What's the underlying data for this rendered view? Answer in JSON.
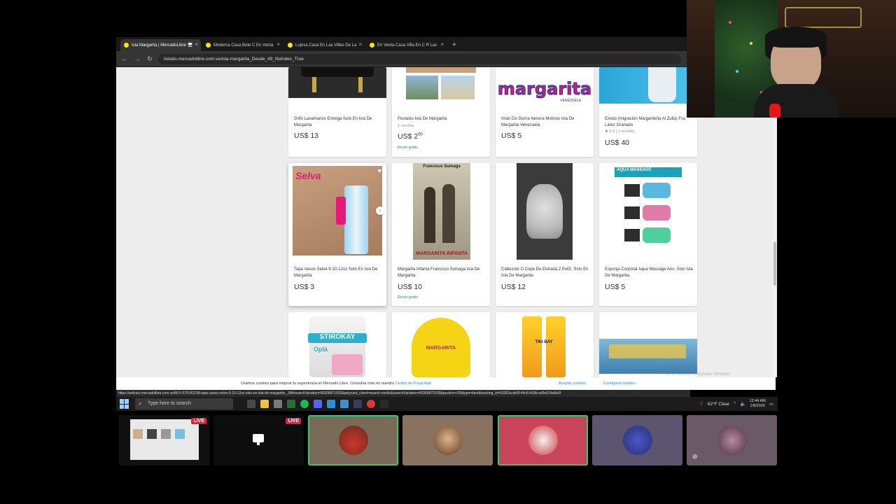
{
  "browser": {
    "tabs": [
      {
        "label": "Isla Margarita | MercadoLibre 🖥",
        "active": true
      },
      {
        "label": "Moderna Casa Bote C En Venta",
        "active": false
      },
      {
        "label": "Lujosa Casa En Las Villas De La",
        "active": false
      },
      {
        "label": "En Venta Casa Villa En C R Las",
        "active": false
      }
    ],
    "new_tab": "+",
    "url": "listado.mercadolibre.com.ve/isla-margarita_Desde_49_NoIndex_True",
    "nav": {
      "back": "←",
      "forward": "→",
      "reload": "↻"
    }
  },
  "products_row1": [
    {
      "title": "Grifo Lavamanos Entrega Solo En Isla De Margarita",
      "meta": "",
      "price": "US$ 13",
      "ship": ""
    },
    {
      "title": "Postales Isla De Margarita",
      "meta": "1 vendido",
      "price": "US$ 2",
      "cents": "50",
      "ship": "Envío gratis"
    },
    {
      "title": "Imán De Goma Nevera Motivos Isla De Margarita Venezuela",
      "meta": "",
      "price": "US$ 5",
      "ship": "",
      "logo": "margarita",
      "logo_sub": "VENEZUELA"
    },
    {
      "title": "Exodo (migración Margariteña Al Zulia) Fco Lárez Granado",
      "meta_star": "★",
      "meta": "5.0 | 1 vendido",
      "price": "US$ 40",
      "ship": ""
    }
  ],
  "products_row2": [
    {
      "title": "Tapa Vasos Selva 9-10-12oz Solo En Isla De Margarita",
      "price": "US$ 3",
      "ship": "",
      "img_text": "Selva",
      "heart": "♥",
      "arrow": "›"
    },
    {
      "title": "Margarita Infanta Francisco Sumaga Isla De Margarita",
      "price": "US$ 10",
      "ship": "Envío gratis",
      "img_top": "Francisco Sumaga",
      "img_bottom": "MARGARITA INFANTA"
    },
    {
      "title": "Cabezote O Cope De Entrada 2 PulG. Solo En Isla De Margarita",
      "price": "US$ 12",
      "ship": ""
    },
    {
      "title": "Esponja Corporal Aqua Massage Anx. Solo Isla De Margarita.",
      "price": "US$ 5",
      "ship": "",
      "img_text": "AQUA MASSAGE"
    }
  ],
  "products_row3": [
    {
      "img_text": "STIROKAY",
      "img_sub": "Oplà"
    },
    {
      "img_text": "MARGARITA"
    },
    {
      "img_text": "TIKI BAY"
    },
    {
      "img_text": ""
    }
  ],
  "cookie_bar": {
    "text": "Usamos cookies para mejorar tu experiencia en Mercado Libre. Consultar más en nuestro ",
    "link": "Centro de Privacidad",
    "accept": "Aceptar cookies",
    "configure": "Configurar cookies"
  },
  "status_url": "https://articulo.mercadolibre.com.ve/MLV-570142158-tapa-vasos-selva-9-10-12oz-solo-en-isla-de-margarita-_JM#searchVariation=66306871033&polycard_client=search-nordic&searchVariation=66306871033&position=29&type=item&tracking_id=53263a-de5f-44c6-b50b-ed3e614a8a0f",
  "watermark": {
    "title": "Windows",
    "sub": "Go to Settings to activate Windows."
  },
  "taskbar": {
    "search_placeholder": "Type here to search",
    "weather": "62°F Clear",
    "time": "12:44 AM",
    "date": "1/8/2026"
  },
  "participants": [
    {
      "badge": "LIVE"
    },
    {
      "badge": "LIVE"
    },
    {
      "badge": ""
    },
    {
      "badge": ""
    },
    {
      "badge": ""
    },
    {
      "badge": ""
    },
    {
      "badge": ""
    }
  ],
  "colors": {
    "ml_yellow": "#ffe600",
    "ml_blue": "#3483fa",
    "ship_green": "#00a650",
    "live_red": "#e41e3f"
  }
}
